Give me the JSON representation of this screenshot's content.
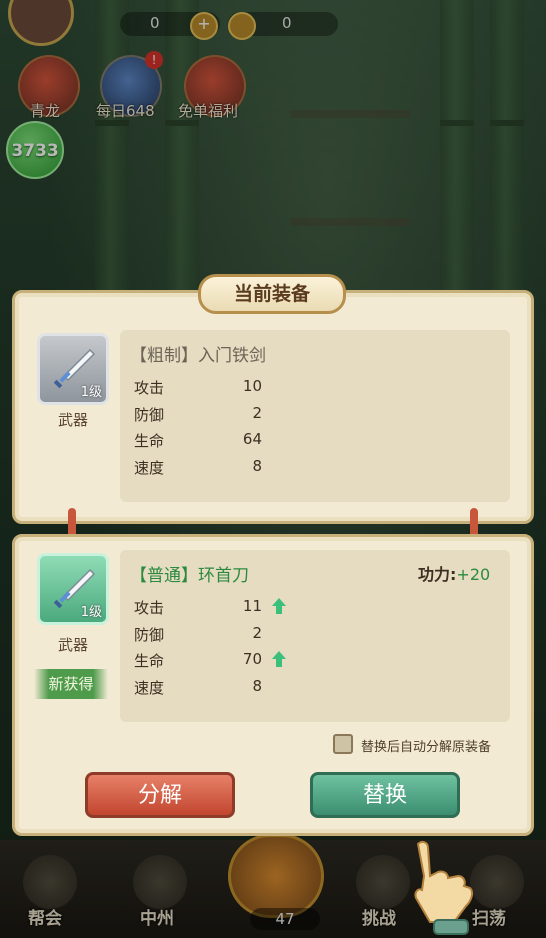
{
  "hud": {
    "coin1": "0",
    "coin1_plus": "+",
    "coin2": "0",
    "events": [
      {
        "label": "青龙"
      },
      {
        "label": "每日648",
        "badge": "!"
      },
      {
        "label": "免单福利"
      }
    ],
    "power": "3733"
  },
  "dialog": {
    "title": "当前装备",
    "current": {
      "name": "【粗制】入门铁剑",
      "slot_level": "1级",
      "slot_type": "武器",
      "stats": [
        {
          "label": "攻击",
          "value": "10"
        },
        {
          "label": "防御",
          "value": "2"
        },
        {
          "label": "生命",
          "value": "64"
        },
        {
          "label": "速度",
          "value": "8"
        }
      ]
    },
    "new": {
      "name": "【普通】环首刀",
      "slot_level": "1级",
      "slot_type": "武器",
      "new_tag": "新获得",
      "power_label": "功力:",
      "power_delta": "+20",
      "stats": [
        {
          "label": "攻击",
          "value": "11",
          "up": true
        },
        {
          "label": "防御",
          "value": "2",
          "up": false
        },
        {
          "label": "生命",
          "value": "70",
          "up": true
        },
        {
          "label": "速度",
          "value": "8",
          "up": false
        }
      ]
    },
    "auto_decompose_label": "替换后自动分解原装备",
    "auto_decompose_checked": false,
    "decompose_button": "分解",
    "replace_button": "替换"
  },
  "bottom_nav": {
    "items": [
      {
        "label": "帮会"
      },
      {
        "label": "中州"
      },
      {
        "label": "挑战"
      },
      {
        "label": "扫荡"
      }
    ],
    "center_count": "47"
  },
  "colors": {
    "accent_green": "#2c8a3f",
    "decompose_red": "#c2452f",
    "replace_green": "#3b8e6f",
    "panel_bg": "#f2ead3"
  }
}
